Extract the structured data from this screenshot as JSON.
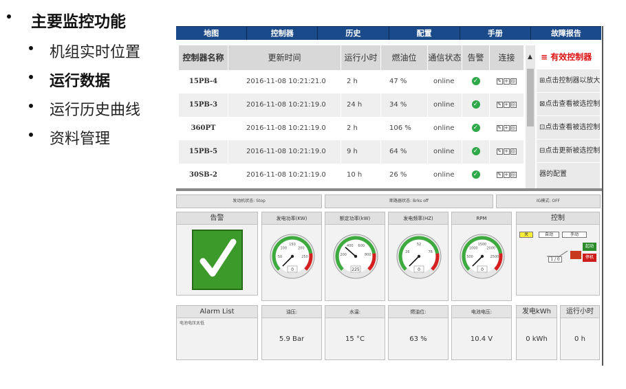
{
  "bullets": {
    "main": "主要监控功能",
    "subs": [
      "机组实时位置",
      "运行数据",
      "运行历史曲线",
      "资料管理"
    ]
  },
  "nav": [
    "地图",
    "控制器",
    "历史",
    "配置",
    "手册",
    "故障报告"
  ],
  "table": {
    "headers": [
      "控制器名称",
      "更新时间",
      "运行小时",
      "燃油位",
      "通信状态",
      "告警",
      "连接"
    ],
    "rows": [
      {
        "name": "15PB-4",
        "time": "2016-11-08 10:21:21.0",
        "hours": "2 h",
        "fuel": "47 %",
        "comm": "online"
      },
      {
        "name": "15PB-3",
        "time": "2016-11-08 10:21:19.0",
        "hours": "24 h",
        "fuel": "34 %",
        "comm": "online"
      },
      {
        "name": "360PT",
        "time": "2016-11-08 10:21:19.0",
        "hours": "2 h",
        "fuel": "106 %",
        "comm": "online"
      },
      {
        "name": "15PB-5",
        "time": "2016-11-08 10:21:19.0",
        "hours": "9 h",
        "fuel": "64 %",
        "comm": "online"
      },
      {
        "name": "30SB-2",
        "time": "2016-11-08 10:21:19.0",
        "hours": "10 h",
        "fuel": "26 %",
        "comm": "online"
      }
    ]
  },
  "side": {
    "title": "≡ 有效控制器",
    "items": [
      "⊞点击控制器以放大",
      "⊠点击查看被选控制",
      "⊡点击查看被选控制",
      "⊟点击更新被选控制",
      "器的配置"
    ]
  },
  "status": {
    "engine": "发动机状态: Stop",
    "breaker": "断路器状态: Brks off",
    "ig": "IG模式: OFF"
  },
  "panels": {
    "alarm": "告警",
    "gauges": [
      {
        "title": "发电功率(KW)",
        "ticks": [
          "50",
          "100",
          "150",
          "200",
          "250"
        ],
        "value": "0",
        "reading": 0
      },
      {
        "title": "额定功率(kW)",
        "ticks": [
          "200",
          "400",
          "600",
          "800"
        ],
        "value": "225",
        "reading": 225
      },
      {
        "title": "发电频率(HZ)",
        "ticks": [
          "26",
          "52",
          "78"
        ],
        "value": "0",
        "reading": 0
      },
      {
        "title": "RPM",
        "ticks": [
          "500",
          "1000",
          "1500",
          "2000",
          "2500"
        ],
        "value": "0",
        "reading": 0
      }
    ],
    "control": {
      "title": "控制",
      "modes": [
        "关",
        "自动",
        "手动"
      ],
      "start": "起动",
      "stop": "停机",
      "io": "1 / 0"
    }
  },
  "bottom": {
    "alarm_list": "Alarm List",
    "alarm_item": "电池电压太低",
    "cells": [
      {
        "label": "油压:",
        "value": "5.9 Bar"
      },
      {
        "label": "水温:",
        "value": "15 °C"
      },
      {
        "label": "燃油位:",
        "value": "63 %"
      },
      {
        "label": "电池电压:",
        "value": "10.4 V"
      },
      {
        "label": "发电kWh",
        "value": "0 kWh"
      },
      {
        "label": "运行小时",
        "value": "0 h"
      }
    ]
  },
  "colors": {
    "nav": "#1a4a8a",
    "ok": "#2fa84a",
    "alarm_green": "#3c9a2a",
    "side_title": "#d11111"
  }
}
